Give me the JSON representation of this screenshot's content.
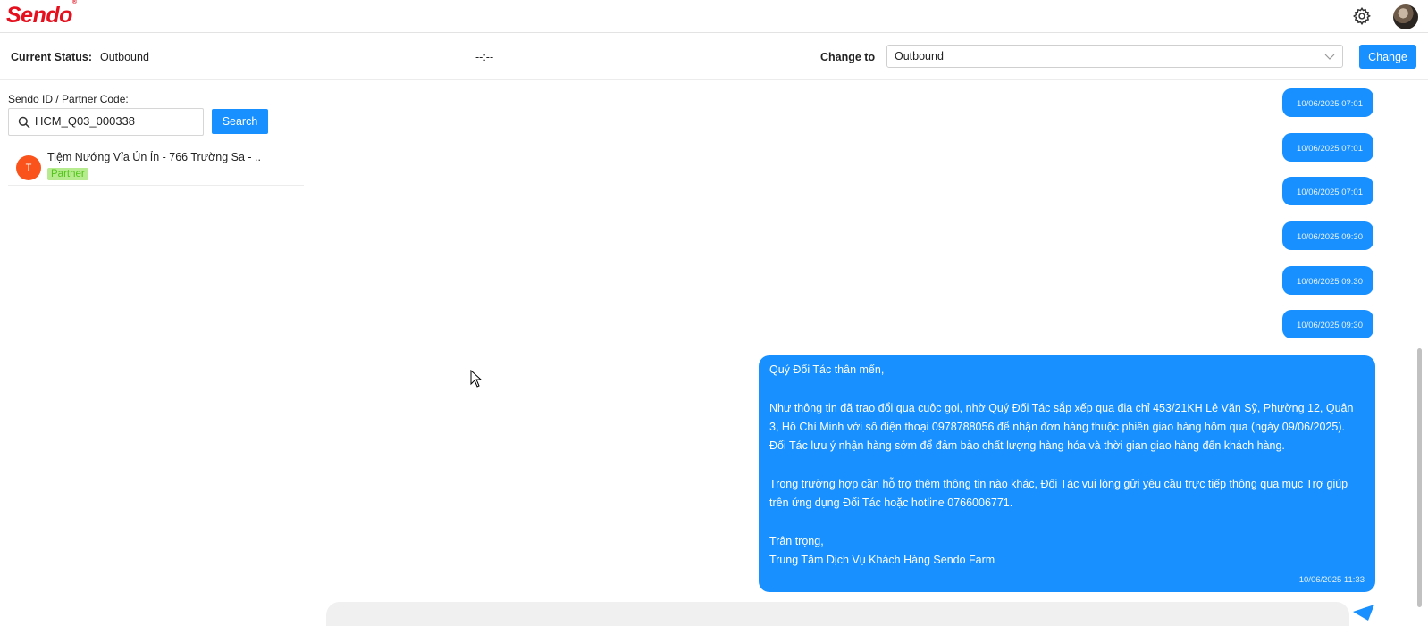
{
  "header": {
    "logo": "Sendo",
    "logo_mark": "®",
    "icons": [
      "gear-icon",
      "user-avatar"
    ]
  },
  "status": {
    "current_label": "Current Status:",
    "current_value": "Outbound",
    "timer": "--:--",
    "change_label": "Change to",
    "change_selected": "Outbound",
    "change_button": "Change"
  },
  "search": {
    "label": "Sendo ID / Partner Code:",
    "value": "HCM_Q03_000338",
    "button": "Search"
  },
  "result": {
    "initial": "T",
    "name": "Tiệm Nướng Vỉa Ủn Ỉn - 766 Trường Sa - ...",
    "tag": "Partner"
  },
  "messages": {
    "small_timestamps": [
      "10/06/2025 07:01",
      "10/06/2025 07:01",
      "10/06/2025 07:01",
      "10/06/2025 09:30",
      "10/06/2025 09:30",
      "10/06/2025 09:30"
    ],
    "big": {
      "lines": [
        "Quý Đối Tác thân mến,",
        "Như thông tin đã trao đổi qua cuộc gọi, nhờ Quý Đối Tác sắp xếp qua địa chỉ 453/21KH Lê Văn Sỹ, Phường 12, Quận",
        "3, Hồ Chí Minh với số điện thoại 0978788056 để nhận đơn hàng thuộc phiên giao hàng hôm qua (ngày 09/06/2025).",
        "Đối Tác lưu ý nhận hàng sớm để đảm bảo chất lượng hàng hóa và thời gian giao hàng đến khách hàng.",
        "Trong trường hợp cần hỗ trợ thêm thông tin nào khác, Đối Tác vui lòng gửi yêu cầu trực tiếp thông qua mục Trợ giúp",
        "trên ứng dụng Đối Tác hoặc hotline 0766006771.",
        "Trân trọng,",
        "Trung Tâm Dịch Vụ Khách Hàng Sendo Farm"
      ],
      "timestamp": "10/06/2025 11:33"
    }
  },
  "colors": {
    "brand": "#e5101d",
    "primary": "#1890ff",
    "avatar_initial_bg": "#fa541c",
    "partner_tag_bg": "#b7eb8f"
  }
}
